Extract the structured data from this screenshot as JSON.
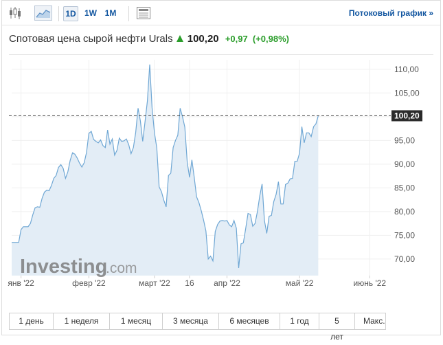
{
  "toolbar": {
    "candles_icon": "candlestick-icon",
    "area_icon": "area-chart-icon",
    "periods": [
      "1D",
      "1W",
      "1M"
    ],
    "active_period": "1D",
    "news_icon": "news-icon",
    "stream_label": "Потоковый график »"
  },
  "header": {
    "instrument": "Спотовая цена сырой нефти Urals",
    "price": "100,20",
    "change": "+0,97",
    "change_pct": "(+0,98%)",
    "direction_color": "#2a9d2a"
  },
  "watermark": {
    "main": "Investing",
    "suffix": ".com"
  },
  "ranges": [
    "1 день",
    "1 неделя",
    "1 месяц",
    "3 месяца",
    "6 месяцев",
    "1 год",
    "5 лет",
    "Макс."
  ],
  "chart_data": {
    "type": "area",
    "y_ticks": [
      "110,00",
      "105,00",
      "100,00",
      "95,00",
      "90,00",
      "85,00",
      "80,00",
      "75,00",
      "70,00"
    ],
    "y_tick_values": [
      110,
      105,
      100,
      95,
      90,
      85,
      80,
      75,
      70
    ],
    "ylim": [
      66.5,
      112
    ],
    "x_ticks": [
      {
        "label": "янв '22",
        "x": "2022-01-03"
      },
      {
        "label": "февр '22",
        "x": "2022-02-01"
      },
      {
        "label": "март '22",
        "x": "2022-03-01"
      },
      {
        "label": "16",
        "x": "2022-03-16"
      },
      {
        "label": "апр '22",
        "x": "2022-04-01"
      },
      {
        "label": "май '22",
        "x": "2022-05-02"
      },
      {
        "label": "июнь '22",
        "x": "2022-06-01"
      }
    ],
    "xlim": [
      "2021-12-30",
      "2022-06-10"
    ],
    "last_value_label": "100,20",
    "last_value": 100.2,
    "line_color": "#6fa7d4",
    "fill_color": "#e3edf6",
    "series": [
      {
        "points": [
          [
            "2021-12-30",
            73.5
          ],
          [
            "2022-01-02",
            73.5
          ],
          [
            "2022-01-03",
            76.2
          ],
          [
            "2022-01-04",
            76.8
          ],
          [
            "2022-01-05",
            76.8
          ],
          [
            "2022-01-06",
            76.8
          ],
          [
            "2022-01-07",
            77.5
          ],
          [
            "2022-01-08",
            79.3
          ],
          [
            "2022-01-09",
            80.8
          ],
          [
            "2022-01-10",
            81.0
          ],
          [
            "2022-01-11",
            80.9
          ],
          [
            "2022-01-12",
            82.8
          ],
          [
            "2022-01-13",
            84.1
          ],
          [
            "2022-01-14",
            84.5
          ],
          [
            "2022-01-15",
            84.4
          ],
          [
            "2022-01-16",
            85.5
          ],
          [
            "2022-01-17",
            87.0
          ],
          [
            "2022-01-18",
            87.6
          ],
          [
            "2022-01-19",
            89.3
          ],
          [
            "2022-01-20",
            89.9
          ],
          [
            "2022-01-21",
            89.1
          ],
          [
            "2022-01-22",
            87.0
          ],
          [
            "2022-01-23",
            88.4
          ],
          [
            "2022-01-24",
            90.8
          ],
          [
            "2022-01-25",
            92.4
          ],
          [
            "2022-01-26",
            92.1
          ],
          [
            "2022-01-27",
            91.3
          ],
          [
            "2022-01-28",
            90.2
          ],
          [
            "2022-01-29",
            89.4
          ],
          [
            "2022-01-30",
            90.3
          ],
          [
            "2022-01-31",
            92.5
          ],
          [
            "2022-02-01",
            96.5
          ],
          [
            "2022-02-02",
            96.9
          ],
          [
            "2022-02-03",
            95.2
          ],
          [
            "2022-02-04",
            94.8
          ],
          [
            "2022-02-05",
            94.5
          ],
          [
            "2022-02-06",
            95.1
          ],
          [
            "2022-02-07",
            93.9
          ],
          [
            "2022-02-08",
            93.5
          ],
          [
            "2022-02-09",
            97.2
          ],
          [
            "2022-02-10",
            94.2
          ],
          [
            "2022-02-11",
            95.3
          ],
          [
            "2022-02-12",
            91.9
          ],
          [
            "2022-02-13",
            92.9
          ],
          [
            "2022-02-14",
            95.5
          ],
          [
            "2022-02-15",
            94.8
          ],
          [
            "2022-02-16",
            94.9
          ],
          [
            "2022-02-17",
            95.3
          ],
          [
            "2022-02-18",
            94.1
          ],
          [
            "2022-02-19",
            92.2
          ],
          [
            "2022-02-20",
            93.5
          ],
          [
            "2022-02-21",
            96.7
          ],
          [
            "2022-02-22",
            101.8
          ],
          [
            "2022-02-23",
            99.1
          ],
          [
            "2022-02-24",
            94.8
          ],
          [
            "2022-02-25",
            99.0
          ],
          [
            "2022-02-26",
            103.3
          ],
          [
            "2022-02-27",
            111.0
          ],
          [
            "2022-02-28",
            101.9
          ],
          [
            "2022-03-01",
            96.6
          ],
          [
            "2022-03-02",
            93.4
          ],
          [
            "2022-03-03",
            85.2
          ],
          [
            "2022-03-04",
            84.2
          ],
          [
            "2022-03-05",
            82.4
          ],
          [
            "2022-03-06",
            81.0
          ],
          [
            "2022-03-07",
            87.6
          ],
          [
            "2022-03-08",
            88.1
          ],
          [
            "2022-03-09",
            93.5
          ],
          [
            "2022-03-10",
            95.0
          ],
          [
            "2022-03-11",
            96.1
          ],
          [
            "2022-03-12",
            101.8
          ],
          [
            "2022-03-13",
            100.0
          ],
          [
            "2022-03-14",
            97.8
          ],
          [
            "2022-03-15",
            90.4
          ],
          [
            "2022-03-16",
            87.2
          ],
          [
            "2022-03-17",
            90.9
          ],
          [
            "2022-03-18",
            87.2
          ],
          [
            "2022-03-19",
            83.1
          ],
          [
            "2022-03-20",
            81.9
          ],
          [
            "2022-03-21",
            80.2
          ],
          [
            "2022-03-22",
            78.2
          ],
          [
            "2022-03-23",
            75.9
          ],
          [
            "2022-03-24",
            70.0
          ],
          [
            "2022-03-25",
            70.6
          ],
          [
            "2022-03-26",
            69.6
          ],
          [
            "2022-03-27",
            75.8
          ],
          [
            "2022-03-28",
            77.3
          ],
          [
            "2022-03-29",
            78.0
          ],
          [
            "2022-03-30",
            78.1
          ],
          [
            "2022-03-31",
            78.0
          ],
          [
            "2022-04-01",
            78.1
          ],
          [
            "2022-04-02",
            77.2
          ],
          [
            "2022-04-03",
            76.8
          ],
          [
            "2022-04-04",
            78.1
          ],
          [
            "2022-04-05",
            76.5
          ],
          [
            "2022-04-06",
            68.1
          ],
          [
            "2022-04-07",
            73.2
          ],
          [
            "2022-04-08",
            73.4
          ],
          [
            "2022-04-09",
            76.4
          ],
          [
            "2022-04-10",
            79.6
          ],
          [
            "2022-04-11",
            79.4
          ],
          [
            "2022-04-12",
            76.9
          ],
          [
            "2022-04-13",
            77.5
          ],
          [
            "2022-04-14",
            80.0
          ],
          [
            "2022-04-15",
            83.3
          ],
          [
            "2022-04-16",
            85.8
          ],
          [
            "2022-04-17",
            78.1
          ],
          [
            "2022-04-18",
            75.4
          ],
          [
            "2022-04-19",
            79.0
          ],
          [
            "2022-04-20",
            79.2
          ],
          [
            "2022-04-21",
            82.1
          ],
          [
            "2022-04-22",
            83.6
          ],
          [
            "2022-04-23",
            86.3
          ],
          [
            "2022-04-24",
            81.6
          ],
          [
            "2022-04-25",
            81.6
          ],
          [
            "2022-04-26",
            85.7
          ],
          [
            "2022-04-27",
            86.0
          ],
          [
            "2022-04-28",
            86.9
          ],
          [
            "2022-04-29",
            87.0
          ],
          [
            "2022-04-30",
            90.6
          ],
          [
            "2022-05-01",
            90.6
          ],
          [
            "2022-05-02",
            92.3
          ],
          [
            "2022-05-03",
            97.9
          ],
          [
            "2022-05-04",
            94.5
          ],
          [
            "2022-05-05",
            96.6
          ],
          [
            "2022-05-06",
            96.6
          ],
          [
            "2022-05-07",
            95.8
          ],
          [
            "2022-05-08",
            97.9
          ],
          [
            "2022-05-09",
            98.5
          ],
          [
            "2022-05-10",
            100.2
          ]
        ]
      }
    ]
  }
}
